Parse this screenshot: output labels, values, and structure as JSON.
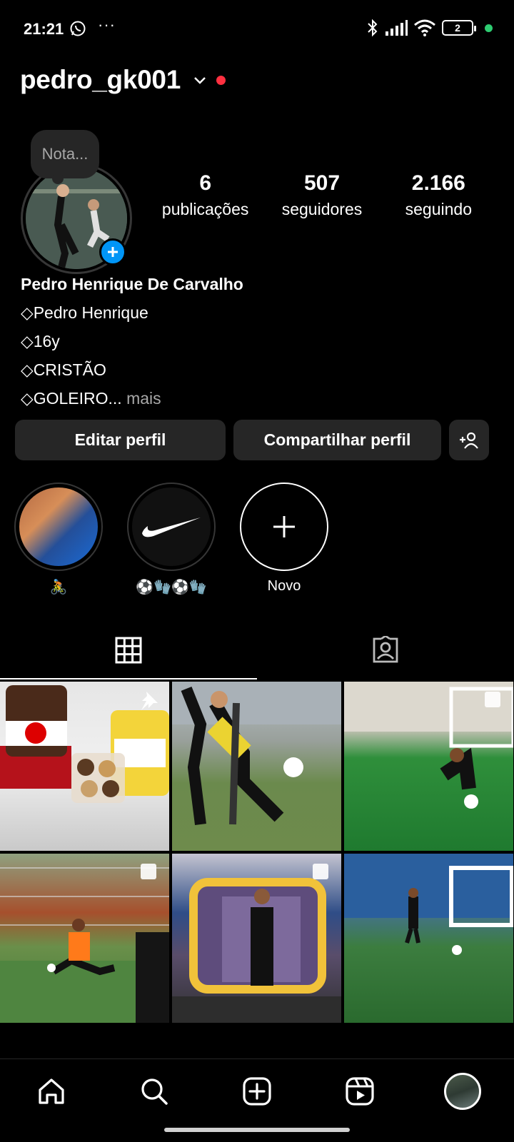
{
  "status_bar": {
    "time": "21:21",
    "dots": "···",
    "battery": "2",
    "icons": [
      "whatsapp-icon",
      "bluetooth-icon",
      "signal-icon",
      "wifi-icon",
      "battery-icon"
    ]
  },
  "header": {
    "username": "pedro_gk001",
    "notification_color": "#ff3040"
  },
  "profile": {
    "note": "Nota...",
    "stats": [
      {
        "value": "6",
        "label": "publicações"
      },
      {
        "value": "507",
        "label": "seguidores"
      },
      {
        "value": "2.166",
        "label": "seguindo"
      }
    ],
    "name": "Pedro Henrique De Carvalho",
    "bio_lines": [
      "◇Pedro Henrique",
      "◇16y",
      "◇CRISTÃO",
      "◇GOLEIRO..."
    ],
    "more_label": "mais"
  },
  "actions": {
    "edit": "Editar perfil",
    "share": "Compartilhar perfil"
  },
  "highlights": [
    {
      "label": "🚴"
    },
    {
      "label": "⚽🧤⚽🧤"
    },
    {
      "label": "Novo"
    }
  ],
  "tabs": [
    "grid-icon",
    "tagged-icon"
  ],
  "posts": [
    {
      "overlay": "pin-icon"
    },
    {
      "overlay": ""
    },
    {
      "overlay": "carousel-icon"
    },
    {
      "overlay": "carousel-icon"
    },
    {
      "overlay": "carousel-icon"
    },
    {
      "overlay": ""
    }
  ],
  "colors": {
    "accent": "#0095f6",
    "button_bg": "#262626",
    "status_green": "#2ecc71"
  }
}
